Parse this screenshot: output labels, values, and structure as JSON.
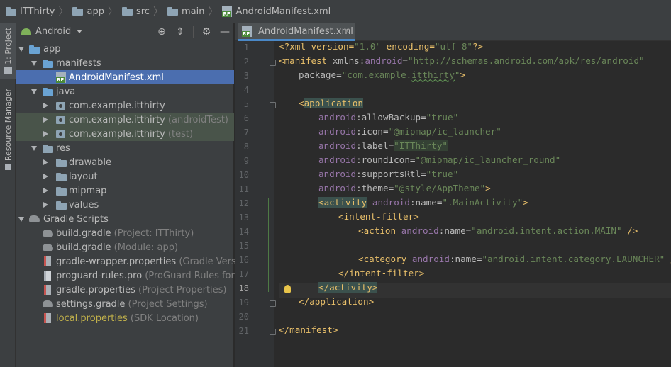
{
  "breadcrumb": {
    "items": [
      "ITThirty",
      "app",
      "src",
      "main",
      "AndroidManifest.xml"
    ]
  },
  "tool_strip": {
    "project_tab": "1: Project",
    "resource_manager_tab": "Resource Manager"
  },
  "project_panel": {
    "view_selector": "Android",
    "tree": [
      {
        "label": "app",
        "hint": ""
      },
      {
        "label": "manifests",
        "hint": ""
      },
      {
        "label": "AndroidManifest.xml",
        "hint": ""
      },
      {
        "label": "java",
        "hint": ""
      },
      {
        "label": "com.example.itthirty",
        "hint": ""
      },
      {
        "label": "com.example.itthirty",
        "hint": "(androidTest)"
      },
      {
        "label": "com.example.itthirty",
        "hint": "(test)"
      },
      {
        "label": "res",
        "hint": ""
      },
      {
        "label": "drawable",
        "hint": ""
      },
      {
        "label": "layout",
        "hint": ""
      },
      {
        "label": "mipmap",
        "hint": ""
      },
      {
        "label": "values",
        "hint": ""
      },
      {
        "label": "Gradle Scripts",
        "hint": ""
      },
      {
        "label": "build.gradle",
        "hint": "(Project: ITThirty)"
      },
      {
        "label": "build.gradle",
        "hint": "(Module: app)"
      },
      {
        "label": "gradle-wrapper.properties",
        "hint": "(Gradle Version)"
      },
      {
        "label": "proguard-rules.pro",
        "hint": "(ProGuard Rules for app)"
      },
      {
        "label": "gradle.properties",
        "hint": "(Project Properties)"
      },
      {
        "label": "settings.gradle",
        "hint": "(Project Settings)"
      },
      {
        "label": "local.properties",
        "hint": "(SDK Location)"
      }
    ]
  },
  "editor": {
    "tab_label": "AndroidManifest.xml",
    "current_line": 18,
    "line_numbers": [
      "1",
      "2",
      "3",
      "4",
      "5",
      "6",
      "7",
      "8",
      "9",
      "10",
      "11",
      "12",
      "13",
      "14",
      "15",
      "16",
      "17",
      "18",
      "19",
      "20",
      "21"
    ],
    "code": {
      "l1": [
        "<?xml version=",
        "\"1.0\"",
        " encoding=",
        "\"utf-8\"",
        "?>"
      ],
      "l2": [
        "<",
        "manifest",
        " xmlns:",
        "android",
        "=",
        "\"http://schemas.android.com/apk/res/android\""
      ],
      "l3": [
        "package=",
        "\"com.example.",
        "itthirty",
        "\"",
        ">"
      ],
      "l5": [
        "<",
        "application"
      ],
      "l6": [
        "android",
        ":allowBackup=",
        "\"true\""
      ],
      "l7": [
        "android",
        ":icon=",
        "\"@mipmap/ic_launcher\""
      ],
      "l8": [
        "android",
        ":label=",
        "\"ITThirty\""
      ],
      "l9": [
        "android",
        ":roundIcon=",
        "\"@mipmap/ic_launcher_round\""
      ],
      "l10": [
        "android",
        ":supportsRtl=",
        "\"true\""
      ],
      "l11": [
        "android",
        ":theme=",
        "\"@style/AppTheme\"",
        ">"
      ],
      "l12": [
        "<",
        "activity",
        " ",
        "android",
        ":name=",
        "\".MainActivity\"",
        ">"
      ],
      "l13": [
        "<",
        "intent-filter",
        ">"
      ],
      "l14": [
        "<",
        "action",
        " ",
        "android",
        ":name=",
        "\"android.intent.action.MAIN\"",
        " />"
      ],
      "l16": [
        "<",
        "category",
        " ",
        "android",
        ":name=",
        "\"android.intent.category.LAUNCHER\"",
        " />"
      ],
      "l17": [
        "</",
        "intent-filter",
        ">"
      ],
      "l18": [
        "</",
        "activity",
        ">"
      ],
      "l19": [
        "</",
        "application",
        ">"
      ],
      "l21": [
        "</",
        "manifest",
        ">"
      ]
    }
  },
  "colors": {
    "selection": "#4b6eaf",
    "test_source_bg": "#49544a",
    "xml_tag": "#e8bf6a",
    "xml_string": "#6a8759",
    "xml_namespace": "#9876aa"
  },
  "icons": [
    "folder-icon",
    "manifest-file-icon",
    "android-icon",
    "locate-icon",
    "collapse-all-icon",
    "gear-icon",
    "minimize-icon",
    "close-icon",
    "gradle-icon",
    "properties-icon",
    "package-icon",
    "lightbulb-icon"
  ]
}
